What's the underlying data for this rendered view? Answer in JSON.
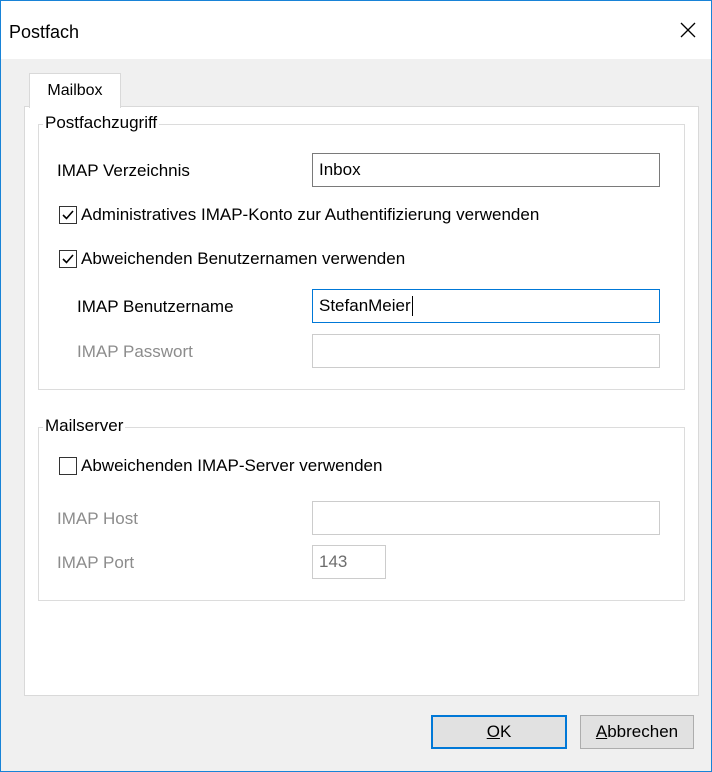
{
  "window": {
    "title": "Postfach",
    "close_glyph": "✕"
  },
  "tabs": [
    {
      "label": "Mailbox",
      "selected": true
    }
  ],
  "mailbox_access": {
    "caption": "Postfachzugriff",
    "imap_folder_label": "IMAP Verzeichnis",
    "imap_folder_value": "Inbox",
    "admin_account_label": "Administratives IMAP-Konto zur Authentifizierung verwenden",
    "admin_account_checked": true,
    "alt_username_label": "Abweichenden Benutzernamen verwenden",
    "alt_username_checked": true,
    "imap_username_label": "IMAP Benutzername",
    "imap_username_value": "StefanMeier",
    "imap_password_label": "IMAP Passwort",
    "imap_password_value": ""
  },
  "mailserver": {
    "caption": "Mailserver",
    "alt_server_label": "Abweichenden IMAP-Server verwenden",
    "alt_server_checked": false,
    "imap_host_label": "IMAP Host",
    "imap_host_value": "",
    "imap_port_label": "IMAP Port",
    "imap_port_value": "143"
  },
  "buttons": {
    "ok_mnemonic": "O",
    "ok_rest": "K",
    "cancel_mnemonic": "A",
    "cancel_rest": "bbrechen"
  },
  "colors": {
    "accent": "#0078d7",
    "disabled_text": "#8c8c8c",
    "face": "#f0f0f0"
  }
}
